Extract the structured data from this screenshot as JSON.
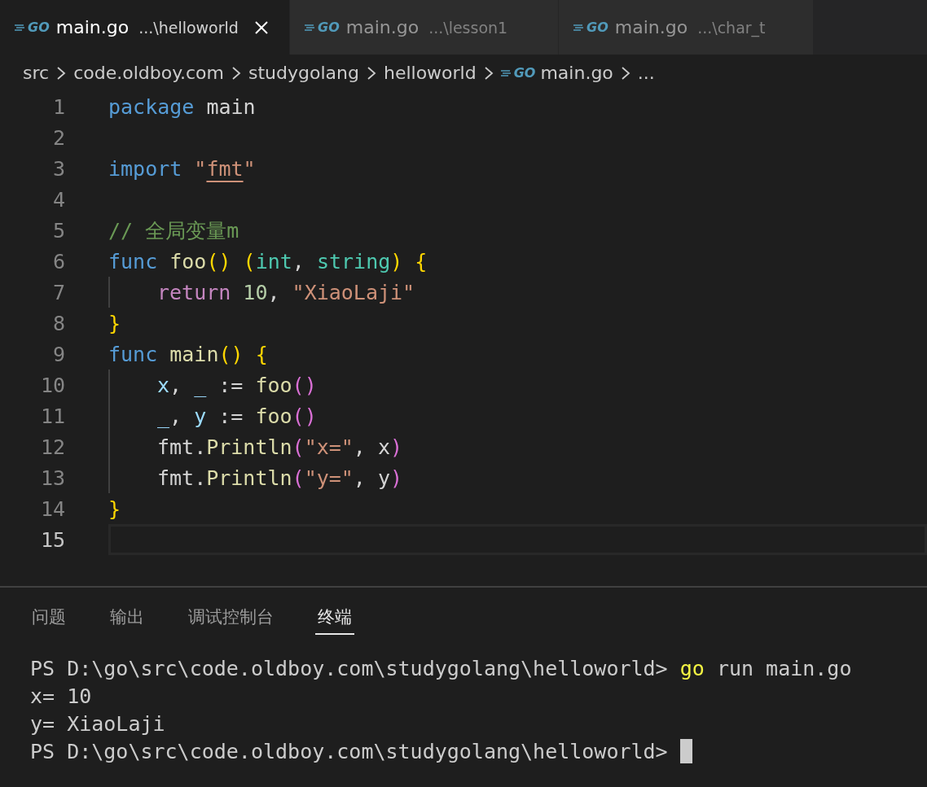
{
  "tabs": [
    {
      "logo": "GO",
      "label": "main.go",
      "description": "...\\helloworld",
      "selected": true,
      "closable": true
    },
    {
      "logo": "GO",
      "label": "main.go",
      "description": "...\\lesson1",
      "selected": false,
      "closable": false
    },
    {
      "logo": "GO",
      "label": "main.go",
      "description": "...\\char_t",
      "selected": false,
      "closable": false
    }
  ],
  "breadcrumb": [
    {
      "label": "src"
    },
    {
      "label": "code.oldboy.com"
    },
    {
      "label": "studygolang"
    },
    {
      "label": "helloworld"
    },
    {
      "logo": "GO",
      "label": "main.go"
    },
    {
      "label": "..."
    }
  ],
  "editor": {
    "lines": [
      {
        "number": "1",
        "current": false,
        "indented": false,
        "tokens": [
          {
            "text": "package",
            "kind": "keyword"
          },
          {
            "text": " main",
            "kind": "plain"
          }
        ]
      },
      {
        "number": "2",
        "current": false,
        "indented": false
      },
      {
        "number": "3",
        "current": false,
        "indented": false,
        "tokens": [
          {
            "text": "import",
            "kind": "keyword"
          },
          {
            "text": " \"",
            "kind": "string"
          },
          {
            "text": "fmt",
            "kind": "string",
            "underline": true
          },
          {
            "text": "\"",
            "kind": "string"
          }
        ]
      },
      {
        "number": "4",
        "current": false,
        "indented": false
      },
      {
        "number": "5",
        "current": false,
        "indented": false,
        "tokens": [
          {
            "text": "// 全局变量m",
            "kind": "comment"
          }
        ]
      },
      {
        "number": "6",
        "current": false,
        "indented": false,
        "tokens": [
          {
            "text": "func",
            "kind": "keyword"
          },
          {
            "text": " foo",
            "kind": "function"
          },
          {
            "text": "()",
            "kind": "bracket"
          },
          {
            "text": " (",
            "kind": "bracket"
          },
          {
            "text": "int",
            "kind": "type"
          },
          {
            "text": ", ",
            "kind": "plain"
          },
          {
            "text": "string",
            "kind": "type"
          },
          {
            "text": ")",
            "kind": "bracket"
          },
          {
            "text": " {",
            "kind": "bracket"
          }
        ]
      },
      {
        "number": "7",
        "current": false,
        "indented": true,
        "tokens": [
          {
            "text": "return",
            "kind": "control"
          },
          {
            "text": " 10",
            "kind": "number"
          },
          {
            "text": ", ",
            "kind": "plain"
          },
          {
            "text": "\"XiaoLaji\"",
            "kind": "string"
          }
        ]
      },
      {
        "number": "8",
        "current": false,
        "indented": false,
        "tokens": [
          {
            "text": "}",
            "kind": "bracket"
          }
        ]
      },
      {
        "number": "9",
        "current": false,
        "indented": false,
        "tokens": [
          {
            "text": "func",
            "kind": "keyword"
          },
          {
            "text": " main",
            "kind": "function"
          },
          {
            "text": "()",
            "kind": "bracket"
          },
          {
            "text": " {",
            "kind": "bracket"
          }
        ]
      },
      {
        "number": "10",
        "current": false,
        "indented": true,
        "tokens": [
          {
            "text": "x",
            "kind": "variable"
          },
          {
            "text": ", ",
            "kind": "plain"
          },
          {
            "text": "_",
            "kind": "variable"
          },
          {
            "text": " := ",
            "kind": "plain"
          },
          {
            "text": "foo",
            "kind": "function"
          },
          {
            "text": "()",
            "kind": "bracket2"
          }
        ]
      },
      {
        "number": "11",
        "current": false,
        "indented": true,
        "tokens": [
          {
            "text": "_",
            "kind": "variable"
          },
          {
            "text": ", ",
            "kind": "plain"
          },
          {
            "text": "y",
            "kind": "variable"
          },
          {
            "text": " := ",
            "kind": "plain"
          },
          {
            "text": "foo",
            "kind": "function"
          },
          {
            "text": "()",
            "kind": "bracket2"
          }
        ]
      },
      {
        "number": "12",
        "current": false,
        "indented": true,
        "tokens": [
          {
            "text": "fmt.",
            "kind": "plain"
          },
          {
            "text": "Println",
            "kind": "function"
          },
          {
            "text": "(",
            "kind": "bracket2"
          },
          {
            "text": "\"x=\"",
            "kind": "string"
          },
          {
            "text": ", x",
            "kind": "plain"
          },
          {
            "text": ")",
            "kind": "bracket2"
          }
        ]
      },
      {
        "number": "13",
        "current": false,
        "indented": true,
        "tokens": [
          {
            "text": "fmt.",
            "kind": "plain"
          },
          {
            "text": "Println",
            "kind": "function"
          },
          {
            "text": "(",
            "kind": "bracket2"
          },
          {
            "text": "\"y=\"",
            "kind": "string"
          },
          {
            "text": ", y",
            "kind": "plain"
          },
          {
            "text": ")",
            "kind": "bracket2"
          }
        ]
      },
      {
        "number": "14",
        "current": false,
        "indented": false,
        "tokens": [
          {
            "text": "}",
            "kind": "bracket"
          }
        ]
      },
      {
        "number": "15",
        "current": true,
        "indented": false
      }
    ]
  },
  "panel": {
    "tabs": [
      {
        "label": "问题",
        "selected": false
      },
      {
        "label": "输出",
        "selected": false
      },
      {
        "label": "调试控制台",
        "selected": false
      },
      {
        "label": "终端",
        "selected": true
      }
    ],
    "terminal": [
      {
        "cursor": false,
        "tokens": [
          {
            "text": "PS D:\\go\\src\\code.oldboy.com\\studygolang\\helloworld> ",
            "kind": "plain"
          },
          {
            "text": "go",
            "kind": "command"
          },
          {
            "text": " run main.go",
            "kind": "plain"
          }
        ]
      },
      {
        "cursor": false,
        "tokens": [
          {
            "text": "x= 10",
            "kind": "plain"
          }
        ]
      },
      {
        "cursor": false,
        "tokens": [
          {
            "text": "y= XiaoLaji",
            "kind": "plain"
          }
        ]
      },
      {
        "cursor": true,
        "tokens": [
          {
            "text": "PS D:\\go\\src\\code.oldboy.com\\studygolang\\helloworld> ",
            "kind": "plain"
          }
        ]
      }
    ]
  }
}
